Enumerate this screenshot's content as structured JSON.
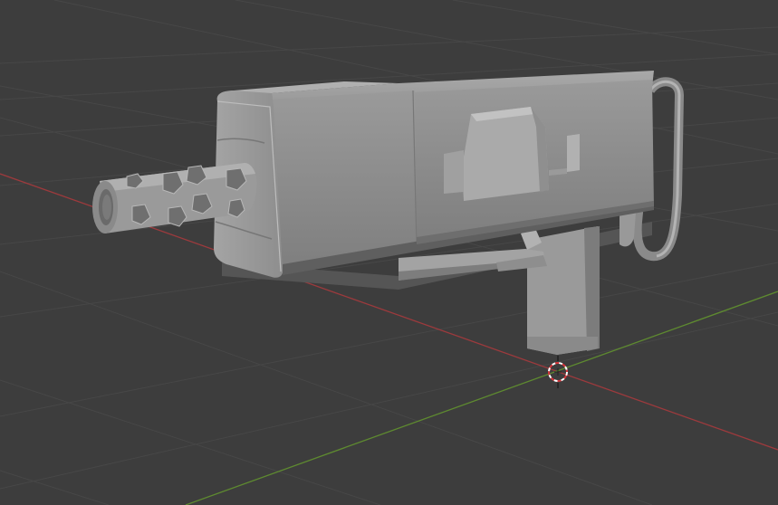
{
  "viewport": {
    "background": "#3d3d3d",
    "grid_color": "#4a4a4a",
    "x_axis_color": "#b43a3f",
    "y_axis_color": "#6b9a33",
    "model_fill": "#8c8c8c",
    "model_shadow": "#666666",
    "model_highlight": "#a6a6a6",
    "cursor_colors": [
      "#ffffff",
      "#d8343a"
    ]
  },
  "scene": {
    "object": "submachine-gun-model",
    "cursor": "3d-cursor-icon"
  }
}
